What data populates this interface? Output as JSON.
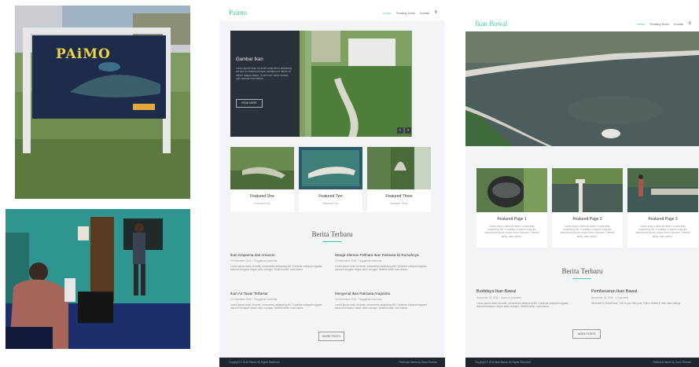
{
  "photo_sign": {
    "sign_text": "PAiMO",
    "icon": "fish-sign-photo"
  },
  "photo_room": {
    "icon": "classroom-photo"
  },
  "site1": {
    "brand": "Paimo",
    "menu": [
      "Home",
      "Tentang Kami",
      "Kontak"
    ],
    "search_icon": "search-icon",
    "slider": {
      "title": "Gambar Ikan",
      "text": "Lorem ipsum dolor sit amet consectetur adipiscing elit sed do eiusmod tempor incididunt ut labore et dolore magna aliqua. Ut enim ad minim veniam, quis nostrud exercitation.",
      "button": "READ MORE",
      "prev": "‹",
      "next": "›"
    },
    "featured": [
      {
        "title": "Featured One",
        "sub": "Featured One"
      },
      {
        "title": "Featured Two",
        "sub": "Featured Two"
      },
      {
        "title": "Featured Three",
        "sub": "Featured Three"
      }
    ],
    "section_title": "Berita Terbaru",
    "posts": [
      {
        "title": "Ikan Arapaima dari Amazon",
        "meta": "10 November 2016 · Tinggalkan komentar",
        "excerpt": "Lorem ipsum dolor sit amet, consectetur adipiscing elit. Curabitur volutpat magnam dolorum tempore neque dolor cumque. Deleniti amet, nam labore."
      },
      {
        "title": "Warga Sleman Pelihara Ikan Raksasa Di Rumahnya",
        "meta": "10 November 2016 · Tinggalkan komentar",
        "excerpt": "Lorem ipsum dolor sit amet, consectetur adipiscing elit. Curabitur volutpat magnam dolorum tempore neque dolor cumque. Deleniti amet, nam labore."
      },
      {
        "title": "Ikan Air Tawar Terbesar",
        "meta": "10 November 2016 · Tinggalkan komentar",
        "excerpt": "Lorem ipsum dolor sit amet, consectetur adipiscing elit. Curabitur volutpat magnam dolorum tempore neque dolor cumque. Deleniti amet, nam labore."
      },
      {
        "title": "Mengenal Ikan Raksasa Arapaima",
        "meta": "10 November 2016 · Tinggalkan komentar",
        "excerpt": "Lorem ipsum dolor sit amet, consectetur adipiscing elit. Curabitur volutpat magnam dolorum tempore neque dolor cumque. Deleniti amet, nam labore."
      }
    ],
    "more_button": "MORE POSTS",
    "footer_left": "Copyright © 2016 Paimo. All Rights Reserved.",
    "footer_right": "Perfectus theme by Good Themes"
  },
  "site2": {
    "brand": "Ikan Bawal",
    "menu": [
      "Home",
      "Tentang Kami",
      "Kontak"
    ],
    "search_icon": "search-icon",
    "featured": [
      {
        "title": "Featured Page 1",
        "sub": "Lorem ipsum dolor sit amet, consectetur adipiscing elit. Curabitur volutpat magnam dolorum tempore neque dolor cumque. Deleniti amet, nam labore."
      },
      {
        "title": "Featured Page 2",
        "sub": "Lorem ipsum dolor sit amet, consectetur adipiscing elit. Curabitur volutpat magnam dolorum tempore neque dolor cumque. Deleniti amet, nam labore."
      },
      {
        "title": "Featured Page 3",
        "sub": "Lorem ipsum dolor sit amet, consectetur adipiscing elit. Curabitur volutpat magnam dolorum tempore neque dolor cumque. Deleniti amet, nam labore."
      }
    ],
    "section_title": "Berita Terbaru",
    "posts": [
      {
        "title": "Budidaya Ikan Bawal",
        "meta": "November 15, 2016 · Leave a Comment",
        "excerpt": "Lorem ipsum dolor sit amet, consectetur adipiscing elit. Curabitur volutpat magnam dolorum tempore neque dolor cumque. Deleniti amet, nam labore."
      },
      {
        "title": "Pembesaran Ikan Bawal",
        "meta": "November 15, 2016 · 1 Comment",
        "excerpt": "Welcome to WordPress. This is your first post. Edit or delete it, then start writing!"
      }
    ],
    "more_button": "MORE POSTS",
    "footer_left": "Copyright © 2016 Ikan Bawal. All Rights Reserved.",
    "footer_right": "Perfectus theme by Good Themes"
  }
}
